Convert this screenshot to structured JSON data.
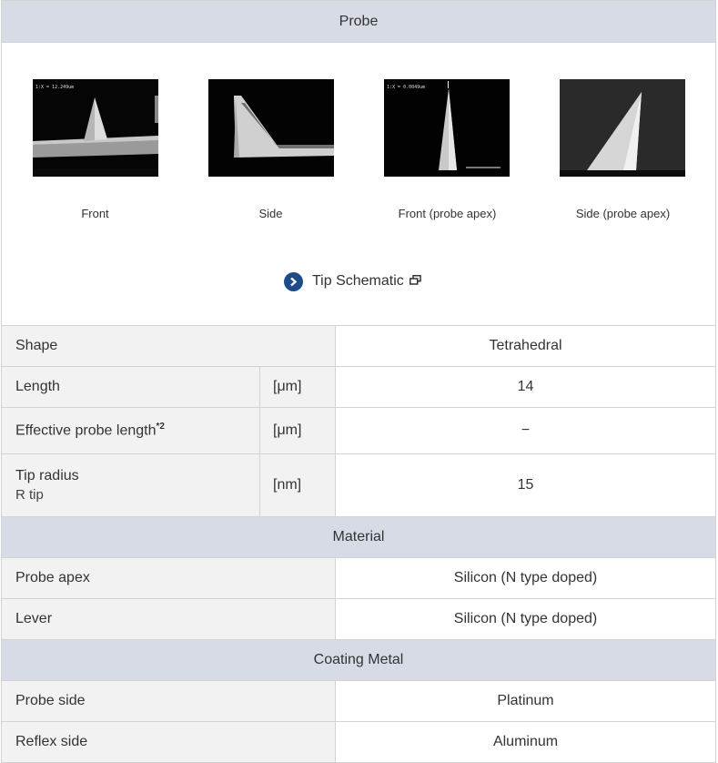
{
  "probe": {
    "title": "Probe",
    "images": [
      {
        "caption": "Front",
        "overlay": "1:X = 12.249um"
      },
      {
        "caption": "Side",
        "overlay": ""
      },
      {
        "caption": "Front (probe apex)",
        "overlay": "1:X = 0.0049um"
      },
      {
        "caption": "Side (probe apex)",
        "overlay": ""
      }
    ],
    "schematic_link": "Tip Schematic",
    "link_icon": "chevron-right-icon",
    "external_icon": "new-window-icon"
  },
  "specs": {
    "shape": {
      "label": "Shape",
      "value": "Tetrahedral"
    },
    "length": {
      "label": "Length",
      "unit": "[μm]",
      "value": "14"
    },
    "effective": {
      "label": "Effective probe length",
      "footnote": "*2",
      "unit": "[μm]",
      "value": "−"
    },
    "tip_radius": {
      "label": "Tip radius",
      "sublabel": "R tip",
      "unit": "[nm]",
      "value": "15"
    }
  },
  "material": {
    "title": "Material",
    "probe_apex": {
      "label": "Probe apex",
      "value": "Silicon (N type doped)"
    },
    "lever": {
      "label": "Lever",
      "value": "Silicon (N type doped)"
    }
  },
  "coating": {
    "title": "Coating Metal",
    "probe_side": {
      "label": "Probe side",
      "value": "Platinum"
    },
    "reflex_side": {
      "label": "Reflex side",
      "value": "Aluminum"
    }
  },
  "colors": {
    "header_bg": "#d7dbe6",
    "label_bg": "#f2f2f2",
    "link_icon": "#1e4b8a",
    "border": "#d3d3d3"
  }
}
